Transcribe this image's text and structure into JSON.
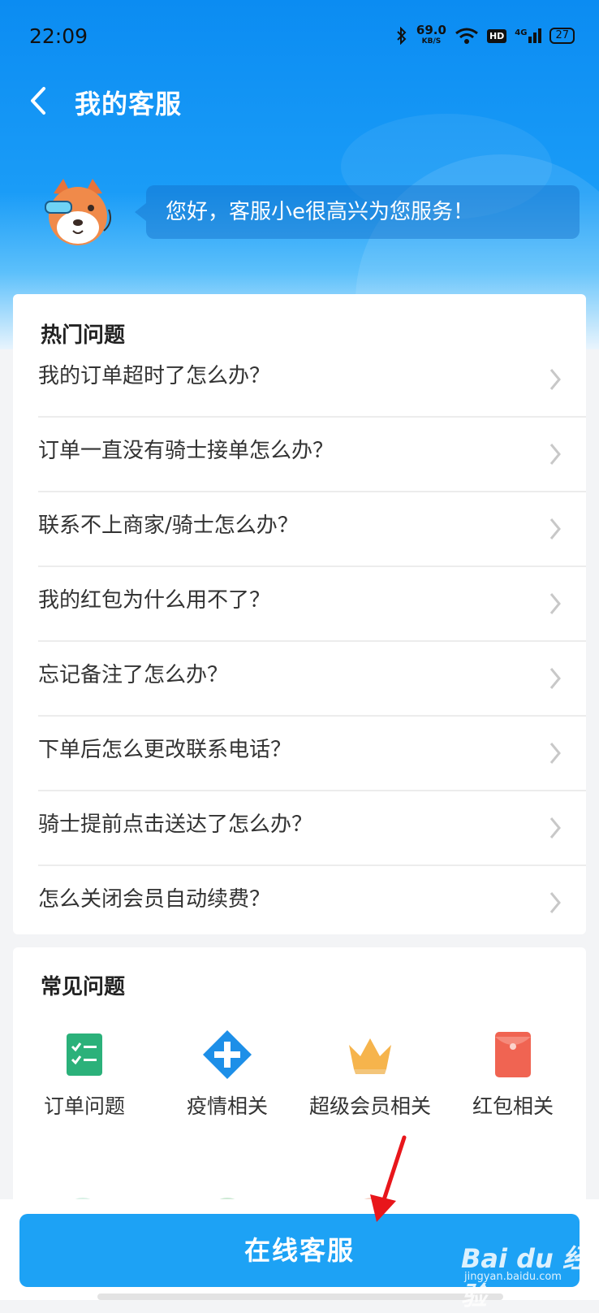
{
  "status_bar": {
    "time": "22:09",
    "net_speed_value": "69.0",
    "net_speed_unit": "KB/S",
    "hd_label": "HD",
    "signal_label": "4G",
    "battery_level": "27",
    "icons": [
      "bluetooth-icon",
      "wifi-icon",
      "signal-icon",
      "battery-icon"
    ]
  },
  "nav": {
    "title": "我的客服",
    "back_icon": "chevron-left-icon"
  },
  "greeting": {
    "text": "您好，客服小e很高兴为您服务！"
  },
  "hot_questions": {
    "title": "热门问题",
    "items": [
      "我的订单超时了怎么办？",
      "订单一直没有骑士接单怎么办？",
      "联系不上商家/骑士怎么办？",
      "我的红包为什么用不了？",
      "忘记备注了怎么办？",
      "下单后怎么更改联系电话？",
      "骑士提前点击送达了怎么办？",
      "怎么关闭会员自动续费？"
    ]
  },
  "common_questions": {
    "title": "常见问题",
    "categories": [
      {
        "label": "订单问题",
        "icon": "order-list-icon",
        "color": "#2bb17a"
      },
      {
        "label": "疫情相关",
        "icon": "medical-cross-icon",
        "color": "#1d8fe8"
      },
      {
        "label": "超级会员相关",
        "icon": "crown-icon",
        "color": "#f6b44c"
      },
      {
        "label": "红包相关",
        "icon": "red-envelope-icon",
        "color": "#f06452"
      }
    ]
  },
  "bottom": {
    "online_service_label": "在线客服"
  },
  "watermark": {
    "brand": "Bai du 经验",
    "url": "jingyan.baidu.com"
  },
  "colors": {
    "header_blue": "#0b8cf2",
    "button_blue": "#1da2f5",
    "annotation_arrow": "#e8161b"
  }
}
